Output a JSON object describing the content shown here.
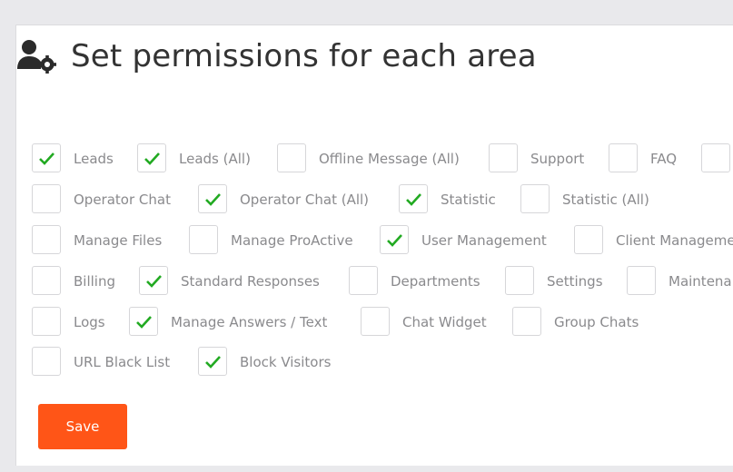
{
  "header": {
    "title": "Set permissions for each area",
    "icon": "user-cog-icon"
  },
  "colors": {
    "check": "#22aa22",
    "save_button": "#ff5517"
  },
  "permissions": [
    [
      {
        "label": "Leads",
        "checked": true
      },
      {
        "label": "Leads (All)",
        "checked": true
      },
      {
        "label": "Offline Message (All)",
        "checked": false
      },
      {
        "label": "Support",
        "checked": false
      },
      {
        "label": "FAQ",
        "checked": false
      },
      {
        "label": "",
        "checked": false
      }
    ],
    [
      {
        "label": "Operator Chat",
        "checked": false
      },
      {
        "label": "Operator Chat (All)",
        "checked": true
      },
      {
        "label": "Statistic",
        "checked": true
      },
      {
        "label": "Statistic (All)",
        "checked": false
      }
    ],
    [
      {
        "label": "Manage Files",
        "checked": false
      },
      {
        "label": "Manage ProActive",
        "checked": false
      },
      {
        "label": "User Management",
        "checked": true
      },
      {
        "label": "Client Manageme",
        "checked": false
      }
    ],
    [
      {
        "label": "Billing",
        "checked": false
      },
      {
        "label": "Standard Responses",
        "checked": true
      },
      {
        "label": "Departments",
        "checked": false
      },
      {
        "label": "Settings",
        "checked": false
      },
      {
        "label": "Maintena",
        "checked": false
      }
    ],
    [
      {
        "label": "Logs",
        "checked": false
      },
      {
        "label": "Manage Answers / Text",
        "checked": true
      },
      {
        "label": "Chat Widget",
        "checked": false
      },
      {
        "label": "Group Chats",
        "checked": false
      }
    ],
    [
      {
        "label": "URL Black List",
        "checked": false
      },
      {
        "label": "Block Visitors",
        "checked": true
      }
    ]
  ],
  "save_label": "Save"
}
